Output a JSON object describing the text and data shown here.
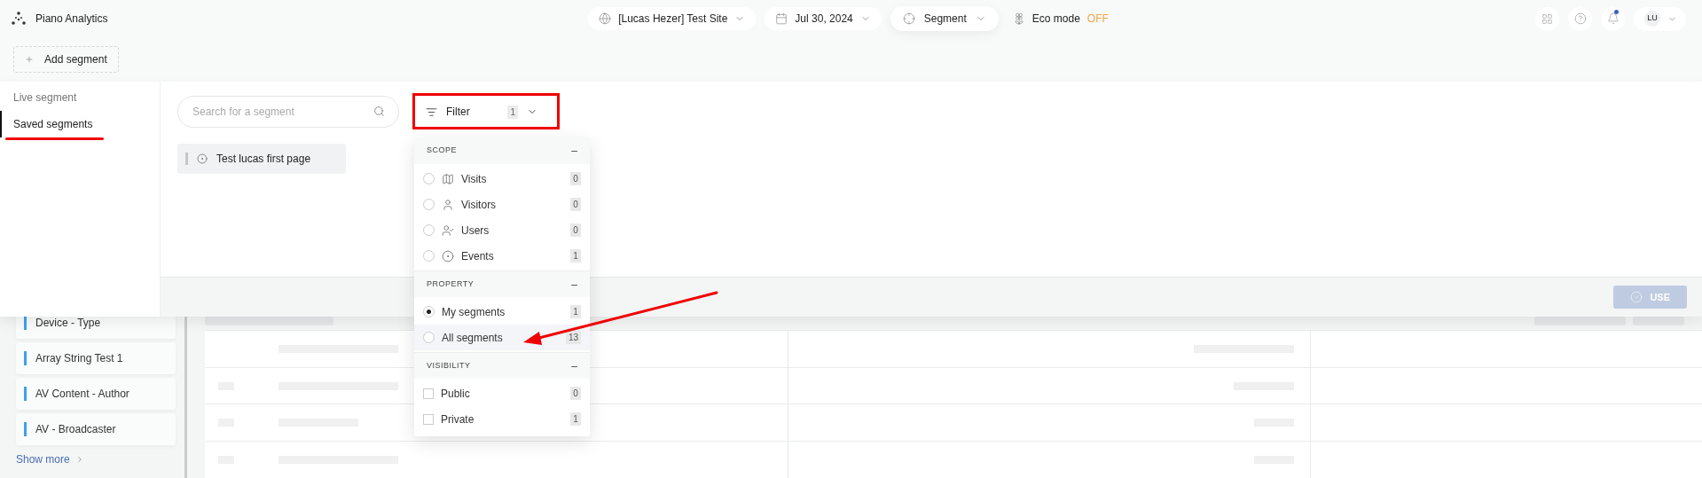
{
  "app": {
    "name": "Piano Analytics"
  },
  "header": {
    "site": "[Lucas Hezer] Test Site",
    "date": "Jul 30, 2024",
    "analysis": "Segment",
    "eco_mode": {
      "label": "Eco mode",
      "status": "OFF"
    },
    "user_initials": "LU",
    "notification_unread": true
  },
  "add_segment": "Add segment",
  "segment_tabs": [
    {
      "label": "Live segment",
      "selected": false
    },
    {
      "label": "Saved segments",
      "selected": true
    }
  ],
  "search": {
    "placeholder": "Search for a segment"
  },
  "filter": {
    "label": "Filter",
    "count": "1",
    "expanded": true
  },
  "segments": [
    {
      "name": "Test lucas first page"
    }
  ],
  "filter_sections": [
    {
      "title": "SCOPE",
      "toggle": "–",
      "kind": "radio",
      "options": [
        {
          "label": "Visits",
          "count": "0",
          "selected": false,
          "hovered": false
        },
        {
          "label": "Visitors",
          "count": "0",
          "selected": false,
          "hovered": false
        },
        {
          "label": "Users",
          "count": "0",
          "selected": false,
          "hovered": false
        },
        {
          "label": "Events",
          "count": "1",
          "selected": false,
          "hovered": false
        }
      ]
    },
    {
      "title": "PROPERTY",
      "toggle": "–",
      "kind": "radio",
      "options": [
        {
          "label": "My segments",
          "count": "1",
          "selected": true,
          "hovered": false
        },
        {
          "label": "All segments",
          "count": "13",
          "selected": false,
          "hovered": true
        }
      ]
    },
    {
      "title": "VISIBILITY",
      "toggle": "–",
      "kind": "checkbox",
      "options": [
        {
          "label": "Public",
          "count": "0",
          "checked": false
        },
        {
          "label": "Private",
          "count": "1",
          "checked": false
        }
      ]
    }
  ],
  "use_button": {
    "label": "USE",
    "disabled": true
  },
  "background_segments": [
    {
      "name": "Device - Type"
    },
    {
      "name": "Array String Test 1"
    },
    {
      "name": "AV Content - Author"
    },
    {
      "name": "AV - Broadcaster"
    }
  ],
  "show_more": "Show more"
}
